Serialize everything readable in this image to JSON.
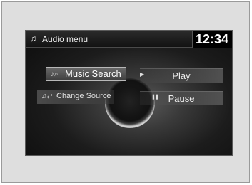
{
  "header": {
    "title": "Audio menu",
    "clock": "12:34",
    "icon": "music-note-icon"
  },
  "menu": {
    "left": [
      {
        "label": "Music Search",
        "icon": "music-search-icon",
        "selected": true
      },
      {
        "label": "Change Source",
        "icon": "change-source-icon",
        "selected": false
      }
    ],
    "right": [
      {
        "label": "Play",
        "icon": "play-icon"
      },
      {
        "label": "Pause",
        "icon": "pause-icon"
      }
    ]
  },
  "colors": {
    "background": "#dedede",
    "screen": "#1c1c1c",
    "text": "#ececec",
    "highlight_border": "#b8b8b8"
  }
}
